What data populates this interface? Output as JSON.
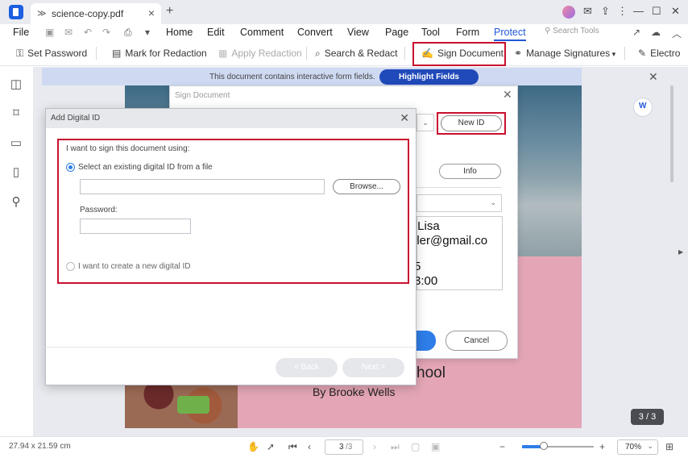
{
  "tab": {
    "title": "science-copy.pdf"
  },
  "menu": {
    "file": "File",
    "items": [
      "Home",
      "Edit",
      "Comment",
      "Convert",
      "View",
      "Page",
      "Tool",
      "Form",
      "Protect"
    ],
    "search_tools": "Search Tools"
  },
  "toolbar": {
    "set_password": "Set Password",
    "mark_redaction": "Mark for Redaction",
    "apply_redaction": "Apply Redaction",
    "search_redact": "Search & Redact",
    "sign_document": "Sign Document",
    "manage_signatures": "Manage Signatures",
    "electronic": "Electro"
  },
  "notice": {
    "text": "This document contains interactive form fields.",
    "highlight_button": "Highlight Fields"
  },
  "page": {
    "school_text": "hool",
    "author": "By Brooke Wells",
    "badge": "3 / 3"
  },
  "sign_dialog": {
    "title": "Sign Document",
    "new_id": "New ID",
    "info": "Info",
    "preview_lines": [
      ":Lisa",
      "ller@gmail.co",
      "5",
      "3:00"
    ],
    "cancel": "Cancel"
  },
  "digital_id_dialog": {
    "title": "Add Digital ID",
    "prompt": "I want to sign this document using:",
    "option_existing": "Select an existing digital ID from a file",
    "option_existing_selected": true,
    "file_value": "",
    "browse": "Browse...",
    "password_label": "Password:",
    "password_value": "",
    "option_new": "I want to create a new digital ID",
    "back": "< Back",
    "next": "Next >"
  },
  "status": {
    "dimensions": "27.94 x 21.59 cm",
    "page_current": "3",
    "page_total": "/3",
    "zoom": "70%",
    "zoom_level": 0.3
  },
  "colors": {
    "accent": "#2358d9",
    "highlight_red": "#c8102e",
    "button_blue": "#2049b9"
  }
}
